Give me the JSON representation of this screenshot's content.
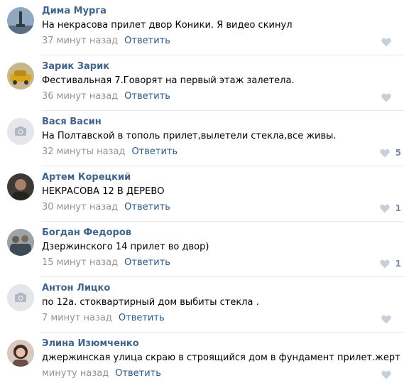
{
  "colors": {
    "author": "#42648b",
    "link": "#2a5885",
    "meta": "#939393",
    "like_icon": "#c5d0db",
    "like_count": "#828a99",
    "divider": "#e7e8ec"
  },
  "comments": [
    {
      "author": "Дима Мурга",
      "text": "На некрасова прилет двор Коники. Я видео скинул",
      "time": "37 минут назад",
      "reply": "Ответить",
      "likes": "",
      "avatar": "photo-monument"
    },
    {
      "author": "Зарик Зарик",
      "text": "Фестивальная 7.Говорят на первый этаж залетела.",
      "time": "36 минут назад",
      "reply": "Ответить",
      "likes": "",
      "avatar": "photo-car"
    },
    {
      "author": "Вася Васин",
      "text": "На Полтавской в тополь прилет,вылетели стекла,все живы.",
      "time": "32 минуты назад",
      "reply": "Ответить",
      "likes": "5",
      "avatar": "camera-placeholder"
    },
    {
      "author": "Артем Корецкий",
      "text": "НЕКРАСОВА 12 В ДЕРЕВО",
      "time": "30 минут назад",
      "reply": "Ответить",
      "likes": "1",
      "avatar": "photo-person-dark"
    },
    {
      "author": "Богдан Федоров",
      "text": "Дзержинского 14 прилет во двор)",
      "time": "15 минут назад",
      "reply": "Ответить",
      "likes": "1",
      "avatar": "photo-people"
    },
    {
      "author": "Антон Лицко",
      "text": "по 12а. стоквартирный дом выбиты стекла .",
      "time": "7 минут назад",
      "reply": "Ответить",
      "likes": "",
      "avatar": "camera-placeholder"
    },
    {
      "author": "Элина Изюмченко",
      "text": "джержинская улица скраю в строящийся дом в фундамент прилет.жерт нет",
      "time": "минуту назад",
      "reply": "Ответить",
      "likes": "",
      "avatar": "photo-woman"
    }
  ]
}
